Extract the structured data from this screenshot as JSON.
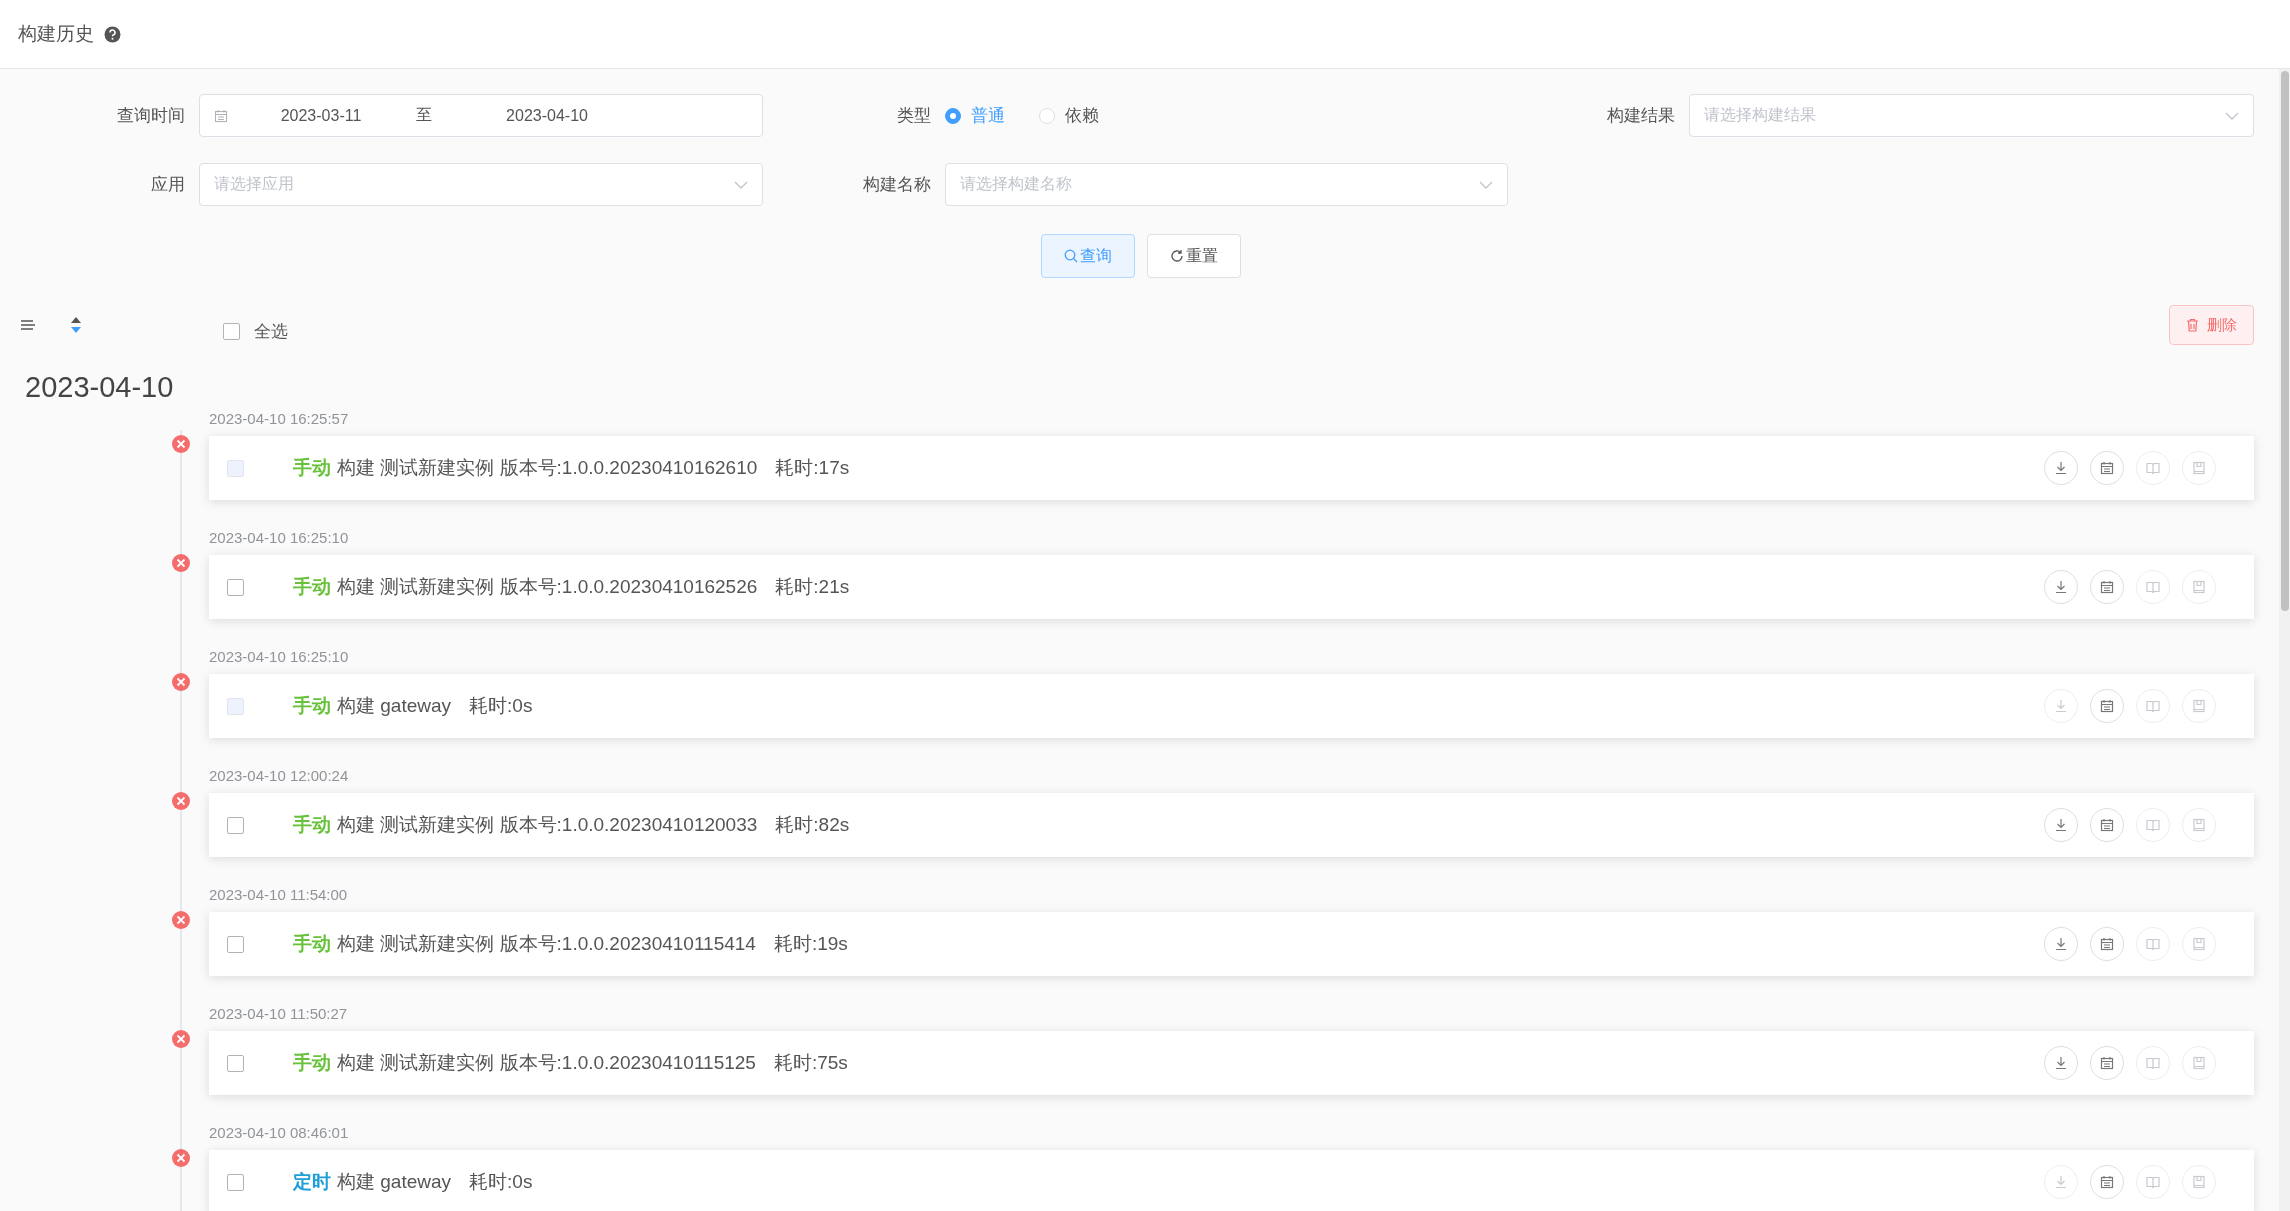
{
  "header": {
    "title": "构建历史"
  },
  "filters": {
    "query_time": {
      "label": "查询时间",
      "start": "2023-03-11",
      "separator": "至",
      "end": "2023-04-10"
    },
    "type": {
      "label": "类型",
      "options": [
        {
          "label": "普通",
          "selected": true
        },
        {
          "label": "依赖",
          "selected": false
        }
      ]
    },
    "build_result": {
      "label": "构建结果",
      "placeholder": "请选择构建结果"
    },
    "app": {
      "label": "应用",
      "placeholder": "请选择应用"
    },
    "build_name": {
      "label": "构建名称",
      "placeholder": "请选择构建名称"
    }
  },
  "buttons": [
    {
      "kind": "primary",
      "label": "查询"
    },
    {
      "kind": "default",
      "label": "重置"
    }
  ],
  "toolbar": {
    "select_all": {
      "label": "全选",
      "checked": false
    },
    "delete_button": {
      "label": "删除"
    }
  },
  "groups": [
    {
      "date": "2023-04-10",
      "items": [
        {
          "time": "2023-04-10 16:25:57",
          "failed": true,
          "checked": false,
          "disabled": true,
          "trigger": "手动",
          "color": "#67c23a",
          "text": "构建 测试新建实例 版本号:1.0.0.20230410162610",
          "duration": "耗时:17s",
          "actions": [
            {
              "kind": "download",
              "disabled": false
            },
            {
              "kind": "calendar",
              "disabled": false
            },
            {
              "kind": "book",
              "disabled": true
            },
            {
              "kind": "save",
              "disabled": true
            }
          ]
        },
        {
          "time": "2023-04-10 16:25:10",
          "failed": true,
          "checked": false,
          "disabled": false,
          "trigger": "手动",
          "color": "#67c23a",
          "text": "构建 测试新建实例 版本号:1.0.0.20230410162526",
          "duration": "耗时:21s",
          "actions": [
            {
              "kind": "download",
              "disabled": false
            },
            {
              "kind": "calendar",
              "disabled": false
            },
            {
              "kind": "book",
              "disabled": true
            },
            {
              "kind": "save",
              "disabled": true
            }
          ]
        },
        {
          "time": "2023-04-10 16:25:10",
          "failed": true,
          "checked": false,
          "disabled": true,
          "trigger": "手动",
          "color": "#67c23a",
          "text": "构建 gateway",
          "duration": "耗时:0s",
          "actions": [
            {
              "kind": "download",
              "disabled": true
            },
            {
              "kind": "calendar",
              "disabled": false
            },
            {
              "kind": "book",
              "disabled": true
            },
            {
              "kind": "save",
              "disabled": true
            }
          ]
        },
        {
          "time": "2023-04-10 12:00:24",
          "failed": true,
          "checked": false,
          "disabled": false,
          "trigger": "手动",
          "color": "#67c23a",
          "text": "构建 测试新建实例 版本号:1.0.0.20230410120033",
          "duration": "耗时:82s",
          "actions": [
            {
              "kind": "download",
              "disabled": false
            },
            {
              "kind": "calendar",
              "disabled": false
            },
            {
              "kind": "book",
              "disabled": true
            },
            {
              "kind": "save",
              "disabled": true
            }
          ]
        },
        {
          "time": "2023-04-10 11:54:00",
          "failed": true,
          "checked": false,
          "disabled": false,
          "trigger": "手动",
          "color": "#67c23a",
          "text": "构建 测试新建实例 版本号:1.0.0.20230410115414",
          "duration": "耗时:19s",
          "actions": [
            {
              "kind": "download",
              "disabled": false
            },
            {
              "kind": "calendar",
              "disabled": false
            },
            {
              "kind": "book",
              "disabled": true
            },
            {
              "kind": "save",
              "disabled": true
            }
          ]
        },
        {
          "time": "2023-04-10 11:50:27",
          "failed": true,
          "checked": false,
          "disabled": false,
          "trigger": "手动",
          "color": "#67c23a",
          "text": "构建 测试新建实例 版本号:1.0.0.20230410115125",
          "duration": "耗时:75s",
          "actions": [
            {
              "kind": "download",
              "disabled": false
            },
            {
              "kind": "calendar",
              "disabled": false
            },
            {
              "kind": "book",
              "disabled": true
            },
            {
              "kind": "save",
              "disabled": true
            }
          ]
        },
        {
          "time": "2023-04-10 08:46:01",
          "failed": true,
          "checked": false,
          "disabled": false,
          "trigger": "定时",
          "color": "#1e9fd8",
          "text": "构建 gateway",
          "duration": "耗时:0s",
          "actions": [
            {
              "kind": "download",
              "disabled": true
            },
            {
              "kind": "calendar",
              "disabled": false
            },
            {
              "kind": "book",
              "disabled": true
            },
            {
              "kind": "save",
              "disabled": true
            }
          ]
        }
      ]
    }
  ]
}
